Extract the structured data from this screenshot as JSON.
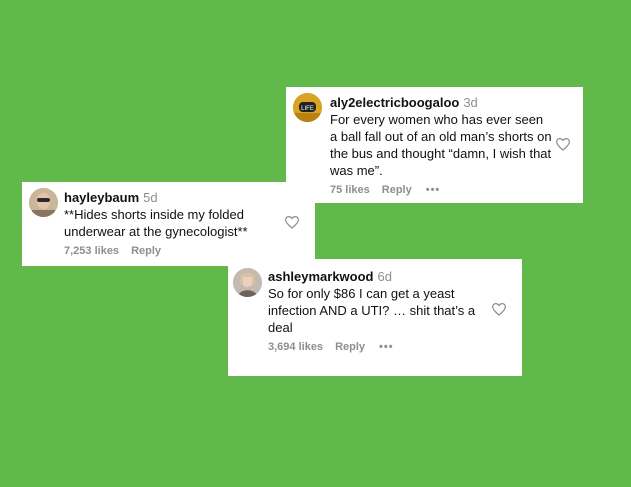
{
  "theme": {
    "background": "#62b94b"
  },
  "comments": [
    {
      "username": "aly2electricboogaloo",
      "age": "3d",
      "text": "For every women who has ever seen a ball fall out of an old man’s shorts on the bus and thought “damn, I wish that was me”.",
      "likes": "75 likes",
      "reply": "Reply",
      "more": "•••",
      "icon": "heart-outline-icon"
    },
    {
      "username": "hayleybaum",
      "age": "5d",
      "text": "**Hides shorts inside my folded underwear at the gynecologist**",
      "likes": "7,253 likes",
      "reply": "Reply",
      "icon": "heart-outline-icon"
    },
    {
      "username": "ashleymarkwood",
      "age": "6d",
      "text": "So for only $86 I can get a yeast infection AND a UTI? … shit that’s a deal",
      "likes": "3,694 likes",
      "reply": "Reply",
      "more": "•••",
      "icon": "heart-outline-icon"
    }
  ]
}
